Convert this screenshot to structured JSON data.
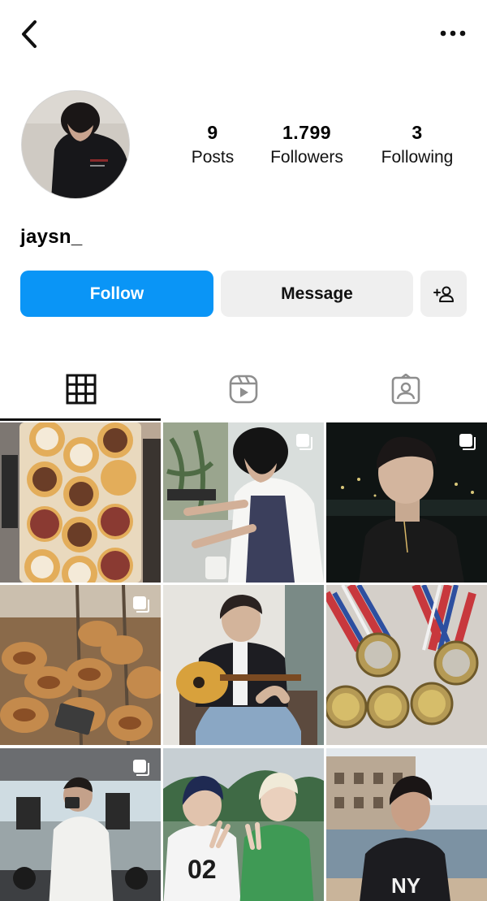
{
  "profile": {
    "username": "jaysn_",
    "stats": [
      {
        "value": "9",
        "label": "Posts"
      },
      {
        "value": "1.799",
        "label": "Followers"
      },
      {
        "value": "3",
        "label": "Following"
      }
    ]
  },
  "actions": {
    "follow_label": "Follow",
    "message_label": "Message"
  },
  "icons": {
    "back": "back-arrow-icon",
    "more": "more-options-icon",
    "add_user": "add-user-icon",
    "grid_tab": "grid-icon",
    "reels_tab": "reels-icon",
    "tagged_tab": "tagged-icon"
  },
  "colors": {
    "follow_button": "#0a95f6",
    "secondary_button": "#efefef",
    "active_tab": "#111111",
    "inactive_tab": "#8e8e8e"
  },
  "posts": [
    {
      "subject": "pastries-box",
      "multi": false
    },
    {
      "subject": "barista-coffee",
      "multi": true
    },
    {
      "subject": "night-portrait",
      "multi": true
    },
    {
      "subject": "bakery-rolls",
      "multi": true
    },
    {
      "subject": "guitar-player",
      "multi": false
    },
    {
      "subject": "medals",
      "multi": false
    },
    {
      "subject": "gym-mirror-selfie",
      "multi": true
    },
    {
      "subject": "two-friends-peace-sign",
      "multi": false
    },
    {
      "subject": "beach-portrait",
      "multi": false
    }
  ]
}
